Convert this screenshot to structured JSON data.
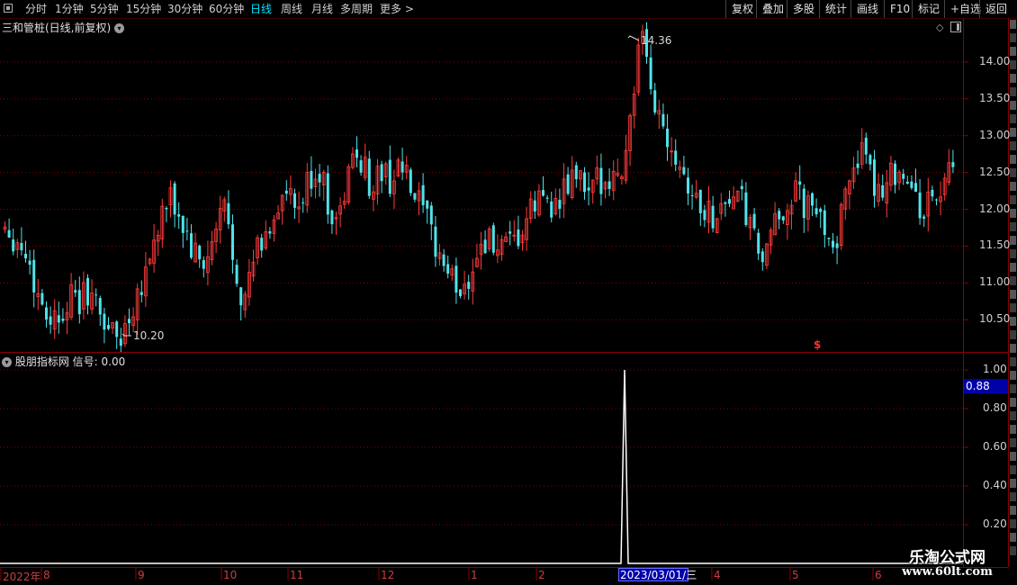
{
  "toolbar": {
    "periods": [
      "分时",
      "1分钟",
      "5分钟",
      "15分钟",
      "30分钟",
      "60分钟",
      "日线",
      "周线",
      "月线",
      "多周期",
      "更多 >"
    ],
    "active_period": "日线",
    "right_buttons": [
      "复权",
      "叠加",
      "多股",
      "统计",
      "画线",
      "F10",
      "标记",
      "+自选",
      "返回"
    ]
  },
  "main_chart": {
    "title": "三和管桩(日线,前复权)",
    "price_ticks": [
      "14.00",
      "13.50",
      "13.00",
      "12.50",
      "12.00",
      "11.50",
      "11.00",
      "10.50"
    ],
    "high_label": "14.36",
    "low_label": "10.20",
    "signal_marker": "$"
  },
  "indicator": {
    "title": "股朋指标网 信号: 0.00",
    "ticks": [
      "1.00",
      "0.80",
      "0.60",
      "0.40",
      "0.20"
    ],
    "current_value": "0.88"
  },
  "date_axis": {
    "labels": [
      "2022年",
      "8",
      "9",
      "10",
      "11",
      "12",
      "1",
      "2",
      "4",
      "5",
      "6"
    ],
    "highlight": "2023/03/01/三"
  },
  "watermark": {
    "title": "乐淘公式网",
    "url": "www.60lt.com"
  },
  "colors": {
    "up": "#ff3b3b",
    "down": "#4fe3ea",
    "grid": "#8b0000",
    "active": "#00e5ff",
    "badge": "#0000a8"
  },
  "chart_data": {
    "type": "candlestick",
    "x_range": [
      "2022-07",
      "2023-06"
    ],
    "ylim": [
      10.1,
      14.5
    ],
    "price_points": [
      11.8,
      11.6,
      11.4,
      10.9,
      10.6,
      10.5,
      10.8,
      10.7,
      10.9,
      10.6,
      10.4,
      10.2,
      10.6,
      11.0,
      11.4,
      11.9,
      12.1,
      11.8,
      11.4,
      11.2,
      11.5,
      12.1,
      11.3,
      10.7,
      11.4,
      11.6,
      12.0,
      12.2,
      11.9,
      12.3,
      12.6,
      12.1,
      11.8,
      12.5,
      12.8,
      12.3,
      12.5,
      12.4,
      12.6,
      12.2,
      12.0,
      11.6,
      11.3,
      11.0,
      10.9,
      11.3,
      11.6,
      11.5,
      11.4,
      11.5,
      11.8,
      12.1,
      12.2,
      12.0,
      12.3,
      12.5,
      12.1,
      12.4,
      12.5,
      12.4,
      13.2,
      14.36,
      13.6,
      13.2,
      12.9,
      12.6,
      12.2,
      12.0,
      11.9,
      12.1,
      12.2,
      12.0,
      11.5,
      11.3,
      11.8,
      12.1,
      12.2,
      12.0,
      11.9,
      11.7,
      11.6,
      12.5,
      12.8,
      12.4,
      12.3,
      12.5,
      12.6,
      12.2,
      12.0,
      12.1,
      12.3,
      12.5
    ],
    "indicator_series": {
      "name": "信号",
      "values": [
        0,
        0,
        1.0,
        0,
        0
      ],
      "peak_index": 2
    }
  }
}
